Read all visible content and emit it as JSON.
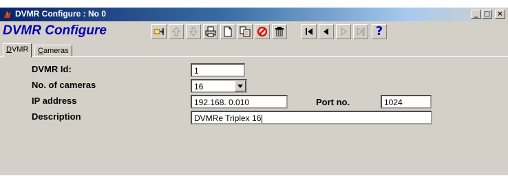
{
  "window": {
    "title": "DVMR Configure : No 0",
    "controls": {
      "minimize": "_",
      "maximize": "□",
      "close": "×"
    }
  },
  "app": {
    "title": "DVMR Configure"
  },
  "toolbar": {
    "buttons": [
      {
        "name": "pick-icon",
        "enabled": true
      },
      {
        "name": "arrow-up-icon",
        "enabled": false
      },
      {
        "name": "arrow-down-icon",
        "enabled": false
      },
      {
        "name": "print-icon",
        "enabled": true
      },
      {
        "name": "new-icon",
        "enabled": true
      },
      {
        "name": "copy-icon",
        "enabled": true
      },
      {
        "name": "cancel-icon",
        "enabled": true
      },
      {
        "name": "delete-icon",
        "enabled": true
      },
      {
        "name": "first-record-icon",
        "enabled": true
      },
      {
        "name": "previous-record-icon",
        "enabled": true
      },
      {
        "name": "next-record-icon",
        "enabled": false
      },
      {
        "name": "last-record-icon",
        "enabled": false
      },
      {
        "name": "help-icon",
        "enabled": true
      }
    ],
    "help_glyph": "?"
  },
  "tabs": [
    {
      "label": "DVMR",
      "accel": "D",
      "rest": "VMR",
      "active": true
    },
    {
      "label": "Cameras",
      "accel": "C",
      "rest": "ameras",
      "active": false
    }
  ],
  "form": {
    "dvmr_id": {
      "label": "DVMR Id:",
      "value": "1"
    },
    "num_cameras": {
      "label": "No. of cameras",
      "value": "16"
    },
    "ip_address": {
      "label": "IP address",
      "value": "192.168. 0.010"
    },
    "port": {
      "label": "Port no.",
      "value": "1024"
    },
    "description": {
      "label": "Description",
      "value": "DVMRe Triplex 16"
    }
  },
  "colors": {
    "title_bar_start": "#0a246a",
    "title_bar_end": "#a6caf0",
    "app_title": "#0000b4",
    "face": "#d4d0c8",
    "cancel_red": "#e00000",
    "help_blue": "#0000c0"
  }
}
